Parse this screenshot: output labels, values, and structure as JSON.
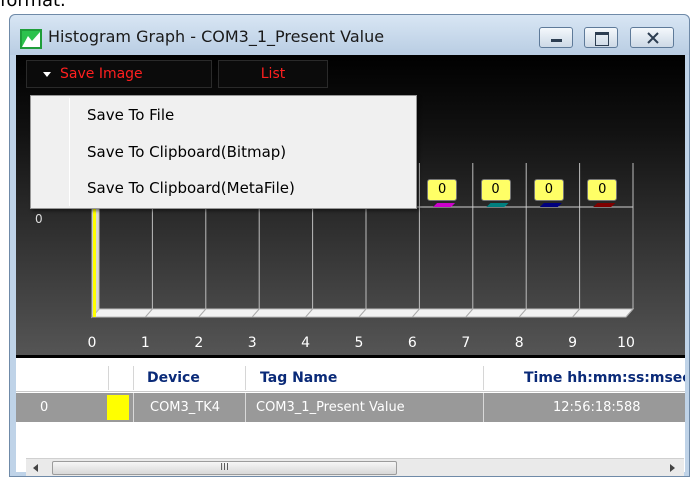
{
  "top_clipped_text": "format.",
  "window": {
    "title": "Histogram Graph - COM3_1_Present Value",
    "minimize_label": "",
    "maximize_label": "",
    "close_label": ""
  },
  "toolbar": {
    "save_image_label": "Save Image",
    "list_label": "List"
  },
  "context_menu": {
    "items": [
      "Save To File",
      "Save To Clipboard(Bitmap)",
      "Save To Clipboard(MetaFile)"
    ]
  },
  "chart_data": {
    "type": "bar",
    "y_zero_label": "0",
    "categories": [
      "0",
      "1",
      "2",
      "3",
      "4",
      "5",
      "6",
      "7",
      "8",
      "9",
      "10"
    ],
    "visible_value_labels": [
      {
        "category": "6",
        "value": "0",
        "color": "#cc00cc"
      },
      {
        "category": "7",
        "value": "0",
        "color": "#007f7f"
      },
      {
        "category": "8",
        "value": "0",
        "color": "#00007f"
      },
      {
        "category": "9",
        "value": "0",
        "color": "#7f0000"
      }
    ],
    "series_colors": [
      "#ffff00"
    ]
  },
  "table": {
    "columns": [
      "",
      "",
      "Device",
      "Tag Name",
      "Time hh:mm:ss:msec"
    ],
    "rows": [
      {
        "index": "0",
        "color": "#ffff00",
        "device": "COM3_TK4",
        "tag_name": "COM3_1_Present Value",
        "time": "12:56:18:588"
      }
    ]
  },
  "scrollbar": {
    "thumb_grip": "III"
  }
}
